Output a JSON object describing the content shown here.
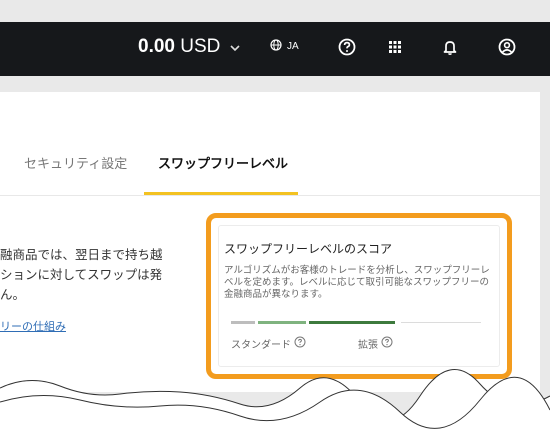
{
  "header": {
    "balance_amount": "0.00",
    "balance_currency": "USD",
    "language": "JA",
    "icons": [
      "chevron-down-icon",
      "globe-icon",
      "help-icon",
      "apps-grid-icon",
      "bell-icon",
      "account-icon"
    ]
  },
  "tabs": [
    {
      "label": "セキュリティ設定",
      "active": false
    },
    {
      "label": "スワップフリーレベル",
      "active": true
    }
  ],
  "content": {
    "lines": [
      "融商品では、翌日まで持ち越",
      "ションに対してスワップは発",
      "ん。"
    ],
    "link": "リーの仕組み"
  },
  "score": {
    "title": "スワップフリーレベルのスコア",
    "description": "アルゴリズムがお客様のトレードを分析し、スワップフリーレベルを定めます。レベルに応じて取引可能なスワップフリーの金融商品が異なります。",
    "levels": [
      "スタンダード",
      "拡張"
    ],
    "bar_colors": [
      "#bdbdbd",
      "#7fb37f",
      "#3d7a3d"
    ]
  },
  "colors": {
    "accent_tab": "#f3c221",
    "highlight_border": "#f39c1e",
    "link": "#2f6db5"
  }
}
